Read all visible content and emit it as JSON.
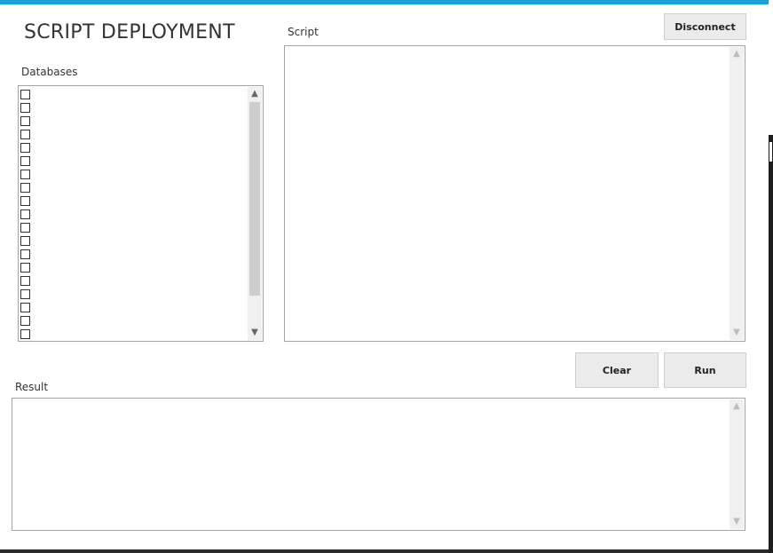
{
  "app": {
    "title": "SCRIPT DEPLOYMENT",
    "accent_color": "#1ba1d8"
  },
  "toolbar": {
    "disconnect_label": "Disconnect",
    "clear_label": "Clear",
    "run_label": "Run"
  },
  "databases": {
    "label": "Databases",
    "items": [
      {
        "label": "",
        "checked": false
      },
      {
        "label": "",
        "checked": false
      },
      {
        "label": "",
        "checked": false
      },
      {
        "label": "",
        "checked": false
      },
      {
        "label": "",
        "checked": false
      },
      {
        "label": "",
        "checked": false
      },
      {
        "label": "",
        "checked": false
      },
      {
        "label": "",
        "checked": false
      },
      {
        "label": "",
        "checked": false
      },
      {
        "label": "",
        "checked": false
      },
      {
        "label": "",
        "checked": false
      },
      {
        "label": "",
        "checked": false
      },
      {
        "label": "",
        "checked": false
      },
      {
        "label": "",
        "checked": false
      },
      {
        "label": "",
        "checked": false
      },
      {
        "label": "",
        "checked": false
      },
      {
        "label": "",
        "checked": false
      },
      {
        "label": "",
        "checked": false
      },
      {
        "label": "",
        "checked": false
      }
    ]
  },
  "script": {
    "label": "Script",
    "value": ""
  },
  "result": {
    "label": "Result",
    "value": ""
  },
  "icons": {
    "scroll_up": "chevron-up-icon",
    "scroll_down": "chevron-down-icon",
    "checkbox": "checkbox-icon"
  }
}
